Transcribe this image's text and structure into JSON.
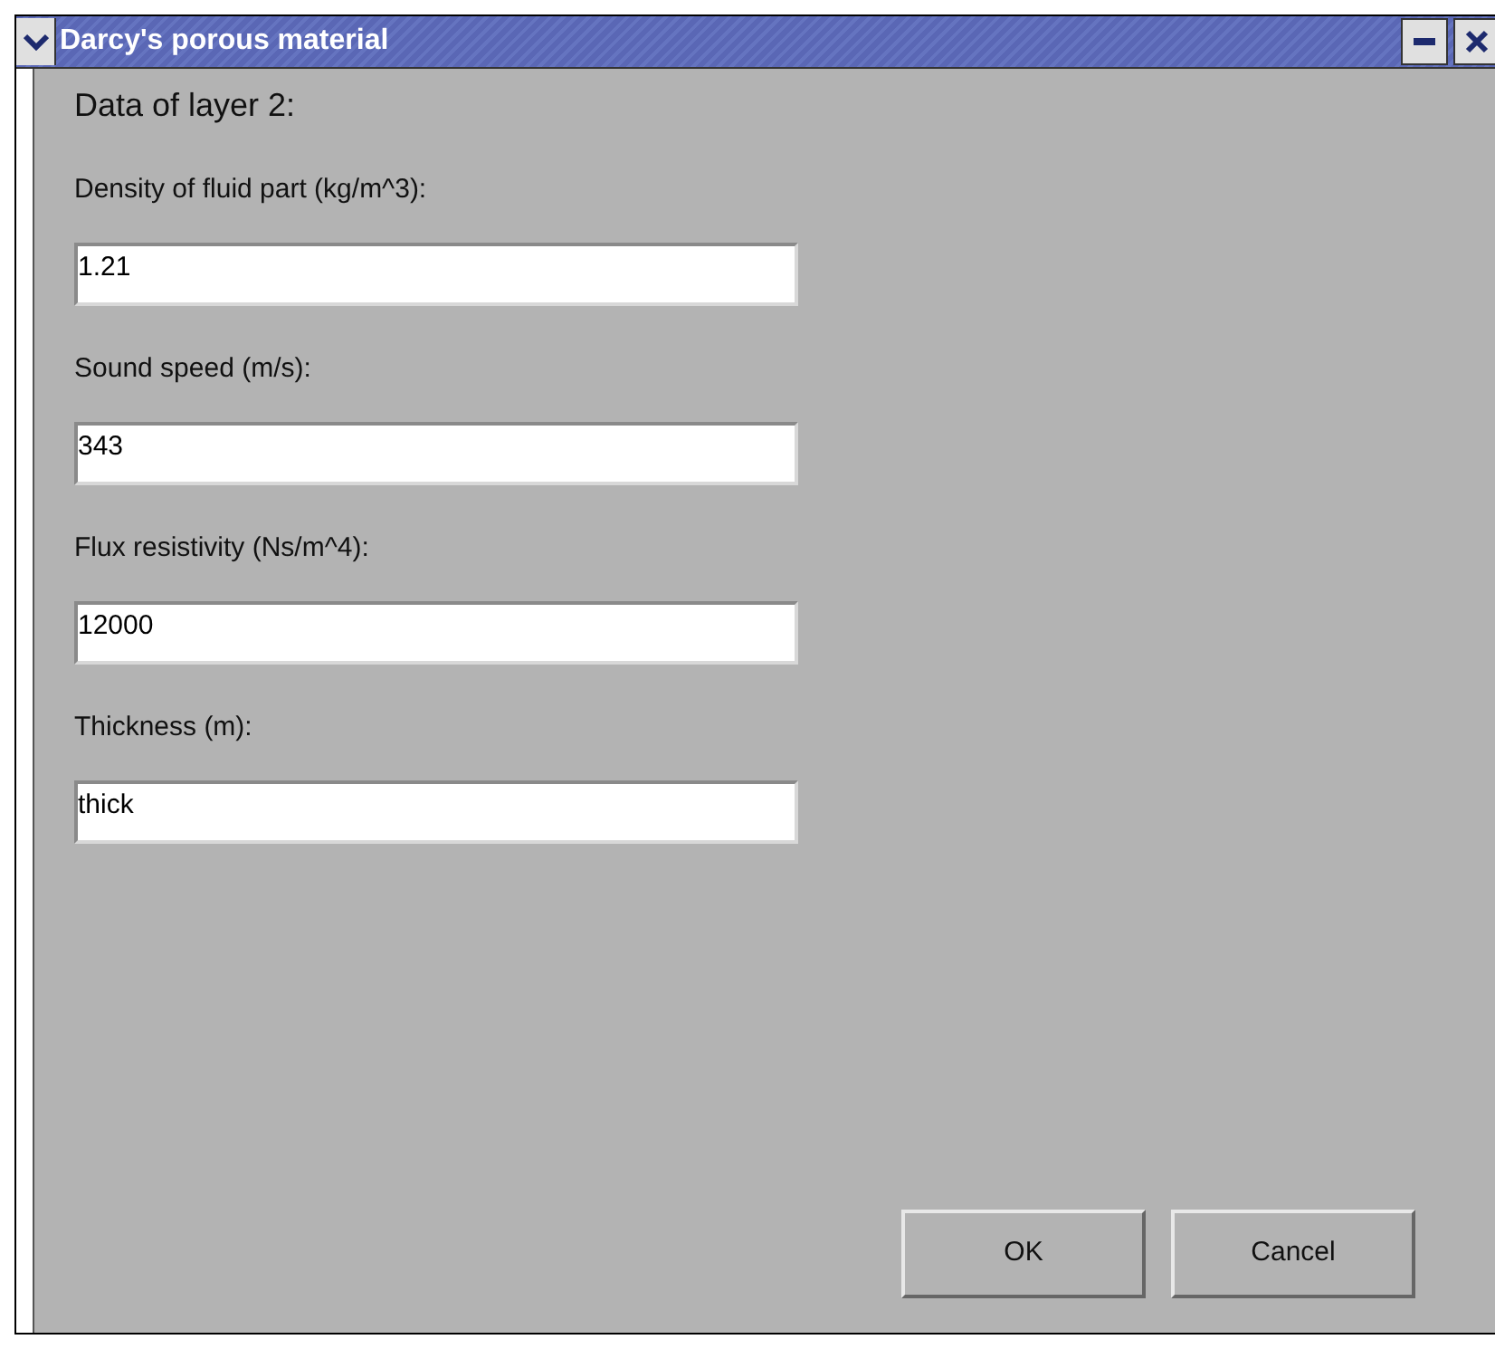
{
  "window": {
    "title": "Darcy's porous material"
  },
  "heading": "Data of layer 2:",
  "fields": [
    {
      "label": "Density of fluid part (kg/m^3):",
      "value": "1.21"
    },
    {
      "label": "Sound speed (m/s):",
      "value": "343"
    },
    {
      "label": "Flux resistivity (Ns/m^4):",
      "value": "12000"
    },
    {
      "label": "Thickness (m):",
      "value": "thick"
    }
  ],
  "buttons": [
    "OK",
    "Cancel"
  ]
}
